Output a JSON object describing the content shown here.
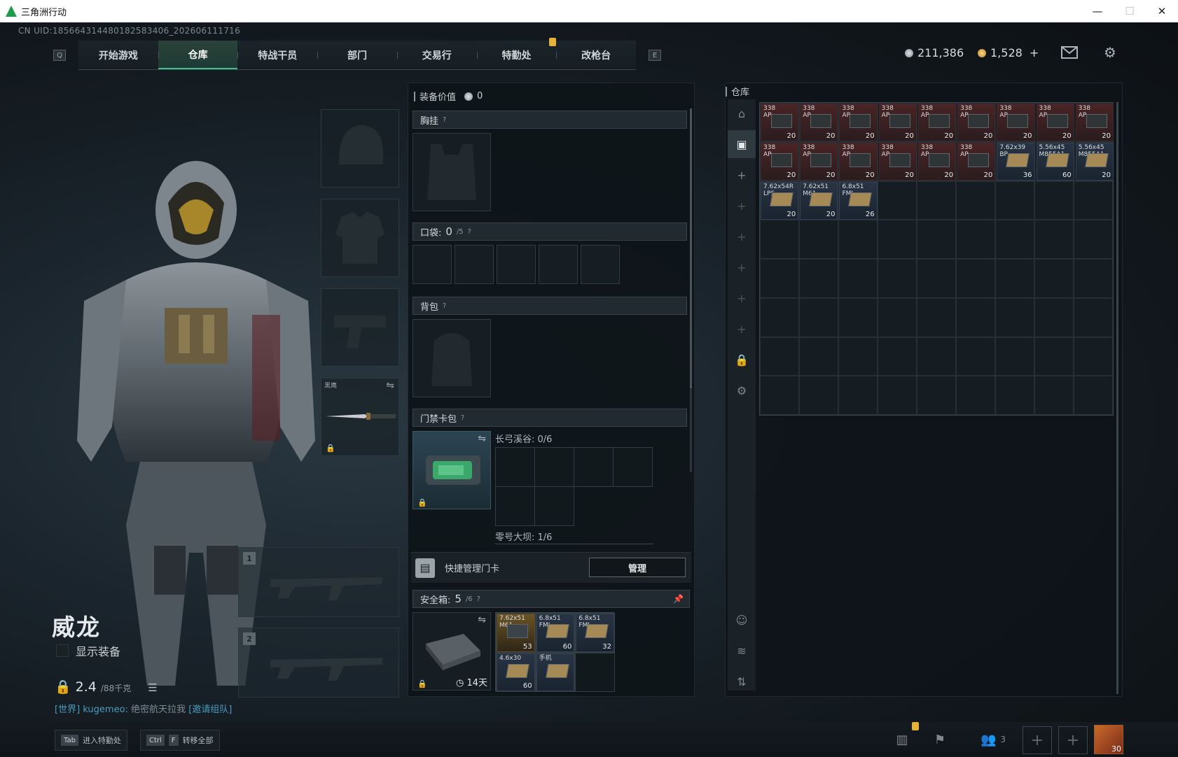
{
  "window": {
    "title": "三角洲行动",
    "minimize": "—",
    "maximize": "☐",
    "close": "✕"
  },
  "uid": "CN UID:1856643144801825834​06_202606111716",
  "nav": {
    "left_key": "Q",
    "right_key": "E",
    "tabs": [
      "开始游戏",
      "仓库",
      "特战干员",
      "部门",
      "交易行",
      "特勤处",
      "改枪台"
    ],
    "active": "仓库"
  },
  "currency": {
    "silver": "211,386",
    "gold": "1,528",
    "plus": "+"
  },
  "icons": {
    "mail": "mail-icon",
    "settings": "gear-icon"
  },
  "character": {
    "name": "威龙",
    "show_equipment": "显示装备",
    "weight": "2.4",
    "weight_max": "/88千克"
  },
  "chat": {
    "channel": "[世界]",
    "user": "kugemeo:",
    "text": "绝密航天拉我",
    "link": "[邀请组队]"
  },
  "equip": {
    "melee_label": "黑鹰"
  },
  "weapon_slots": [
    "1",
    "2"
  ],
  "loadout": {
    "value_label": "装备价值",
    "value": "0",
    "chest_rig": "胸挂",
    "pockets": "口袋:",
    "pockets_count": "0",
    "pockets_max": "/5",
    "backpack": "背包",
    "keycard_case": "门禁卡包",
    "map1": "长弓溪谷: 0/6",
    "map2": "零号大坝: 1/6",
    "quick_manage": "快捷管理门卡",
    "manage_btn": "管理",
    "safe_box": "安全箱:",
    "safe_count": "5",
    "safe_max": "/6",
    "safe_days": "14天"
  },
  "stash": {
    "title": "仓库"
  },
  "stash_items": [
    {
      "n": "338\nAP",
      "c": "20",
      "t": "red"
    },
    {
      "n": "338\nAP",
      "c": "20",
      "t": "red"
    },
    {
      "n": "338\nAP",
      "c": "20",
      "t": "red"
    },
    {
      "n": "338\nAP",
      "c": "20",
      "t": "red"
    },
    {
      "n": "338\nAP",
      "c": "20",
      "t": "red"
    },
    {
      "n": "338\nAP",
      "c": "20",
      "t": "red"
    },
    {
      "n": "338\nAP",
      "c": "20",
      "t": "red"
    },
    {
      "n": "338\nAP",
      "c": "20",
      "t": "red"
    },
    {
      "n": "338\nAP",
      "c": "20",
      "t": "red"
    },
    {
      "n": "338\nAP",
      "c": "20",
      "t": "red"
    },
    {
      "n": "338\nAP",
      "c": "20",
      "t": "red"
    },
    {
      "n": "338\nAP",
      "c": "20",
      "t": "red"
    },
    {
      "n": "338\nAP",
      "c": "20",
      "t": "red"
    },
    {
      "n": "338\nAP",
      "c": "20",
      "t": "red"
    },
    {
      "n": "338\nAP",
      "c": "20",
      "t": "red"
    },
    {
      "n": "7.62x39\nBP",
      "c": "36",
      "t": "blue"
    },
    {
      "n": "5.56x45\nM855A1",
      "c": "60",
      "t": "blue"
    },
    {
      "n": "5.56x45\nM855A1",
      "c": "20",
      "t": "blue"
    },
    {
      "n": "7.62x54R\nLPS",
      "c": "20",
      "t": "blue"
    },
    {
      "n": "7.62x51\nM61",
      "c": "20",
      "t": "blue"
    },
    {
      "n": "6.8x51\nFMJ",
      "c": "26",
      "t": "blue"
    }
  ],
  "safe_items": [
    {
      "n": "7.62x51\nM61",
      "c": "53",
      "t": "gold"
    },
    {
      "n": "6.8x51\nFMJ",
      "c": "60",
      "t": "blue"
    },
    {
      "n": "6.8x51\nFMJ",
      "c": "32",
      "t": "blue"
    },
    {
      "n": "4.6x30",
      "c": "60",
      "t": "blue"
    },
    {
      "n": "手机",
      "c": "",
      "t": "blue"
    }
  ],
  "bottom": {
    "hint1_key": "Tab",
    "hint1": "进入特勤处",
    "hint2_key1": "Ctrl",
    "hint2_key2": "F",
    "hint2": "转移全部",
    "friends": "3",
    "avatar_level": "30"
  }
}
